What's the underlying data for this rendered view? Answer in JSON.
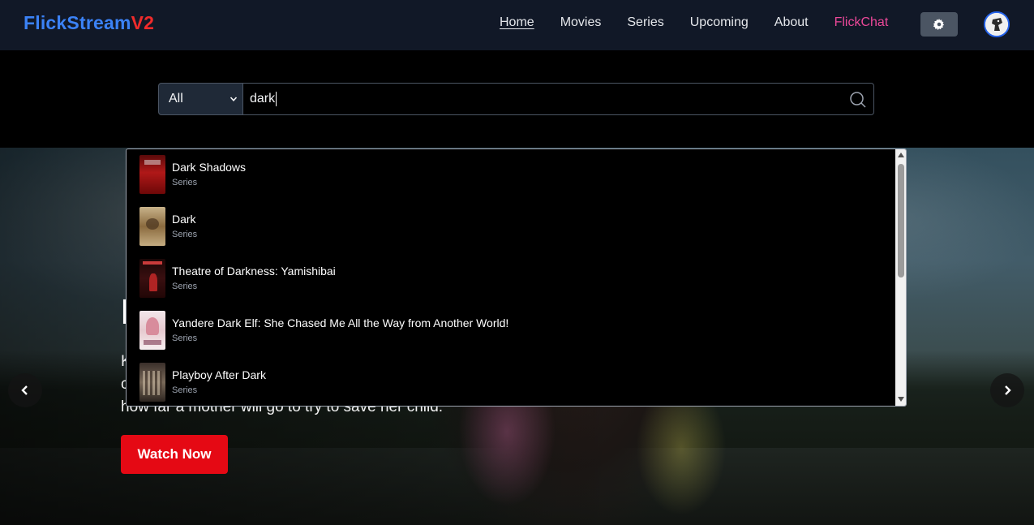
{
  "brand": {
    "part1": "FlickStream",
    "part2": "V2"
  },
  "nav": {
    "items": [
      {
        "label": "Home"
      },
      {
        "label": "Movies"
      },
      {
        "label": "Series"
      },
      {
        "label": "Upcoming"
      },
      {
        "label": "About"
      },
      {
        "label": "FlickChat"
      }
    ],
    "theme_icon": "gear-icon",
    "accent_chat": "#ec4899",
    "brand_color_1": "#3b82f6",
    "brand_color_2": "#ef2b2b"
  },
  "search": {
    "filter_selected": "All",
    "query": "dark",
    "icon": "search-icon"
  },
  "results": [
    {
      "title": "Dark Shadows",
      "type": "Series"
    },
    {
      "title": "Dark",
      "type": "Series"
    },
    {
      "title": "Theatre of Darkness: Yamishibai",
      "type": "Series"
    },
    {
      "title": "Yandere Dark Elf: She Chased Me All the Way from Another World!",
      "type": "Series"
    },
    {
      "title": "Playboy After Dark",
      "type": "Series"
    }
  ],
  "hero": {
    "desc_lines": [
      "K",
      "c",
      "how far a mother will go to try to save her child."
    ],
    "watch_label": "Watch Now",
    "watch_color": "#e50914"
  }
}
